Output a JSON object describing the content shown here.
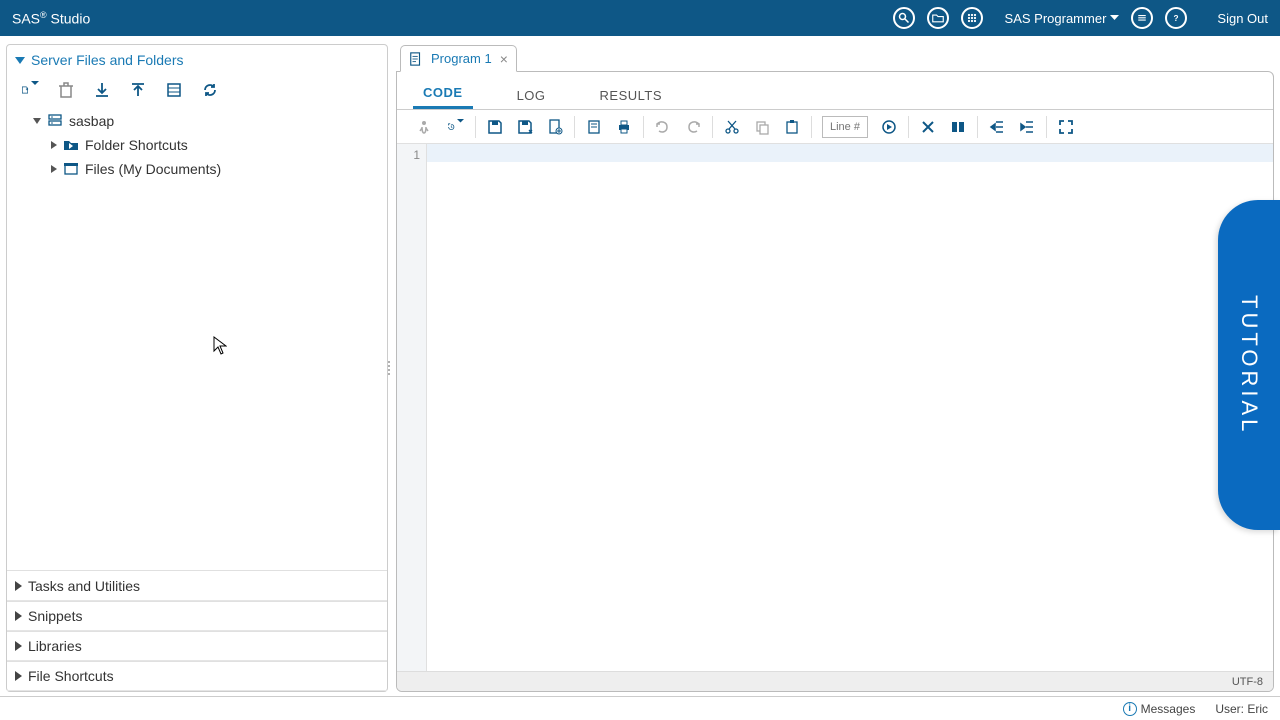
{
  "topbar": {
    "title_prefix": "SAS",
    "title_suffix": " Studio",
    "user": "SAS Programmer",
    "signout": "Sign Out"
  },
  "sidebar": {
    "sections": {
      "files": "Server Files and Folders",
      "tasks": "Tasks and Utilities",
      "snippets": "Snippets",
      "libraries": "Libraries",
      "shortcuts": "File Shortcuts"
    },
    "tree": {
      "root": "sasbap",
      "folder_shortcuts": "Folder Shortcuts",
      "files_item": "Files (My Documents)"
    }
  },
  "content": {
    "tab_label": "Program 1",
    "viewtabs": {
      "code": "CODE",
      "log": "LOG",
      "results": "RESULTS"
    },
    "line_placeholder": "Line #",
    "gutter_first": "1",
    "encoding": "UTF-8"
  },
  "footer": {
    "messages": "Messages",
    "user_label": "User: Eric"
  },
  "tutorial": "TUTORIAL"
}
